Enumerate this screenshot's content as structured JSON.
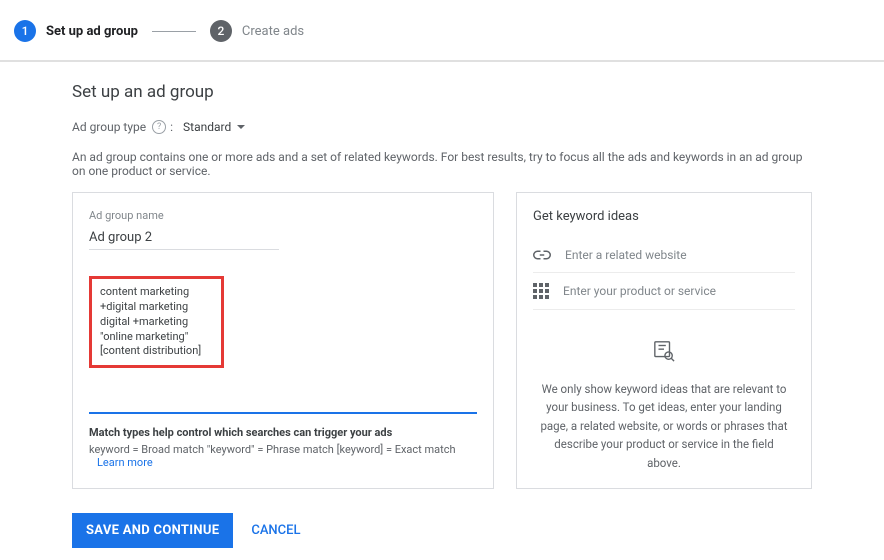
{
  "stepper": {
    "step1_num": "1",
    "step1_label": "Set up ad group",
    "step2_num": "2",
    "step2_label": "Create ads"
  },
  "page": {
    "title": "Set up an ad group",
    "type_label": "Ad group type",
    "type_value": "Standard",
    "description": "An ad group contains one or more ads and a set of related keywords. For best results, try to focus all the ads and keywords in an ad group on one product or service."
  },
  "adgroup": {
    "name_label": "Ad group name",
    "name_value": "Ad group 2",
    "keywords": {
      "line1": "content marketing",
      "line2": "+digital marketing",
      "line3": "digital +marketing",
      "line4": "\"online marketing\"",
      "line5": "[content distribution]"
    },
    "match_title": "Match types help control which searches can trigger your ads",
    "match_desc": "keyword = Broad match   \"keyword\" = Phrase match   [keyword] = Exact match",
    "learn_more": "Learn more"
  },
  "ideas": {
    "title": "Get keyword ideas",
    "website_placeholder": "Enter a related website",
    "product_placeholder": "Enter your product or service",
    "empty_text": "We only show keyword ideas that are relevant to your business. To get ideas, enter your landing page, a related website, or words or phrases that describe your product or service in the field above."
  },
  "footer": {
    "save": "SAVE AND CONTINUE",
    "cancel": "CANCEL"
  }
}
